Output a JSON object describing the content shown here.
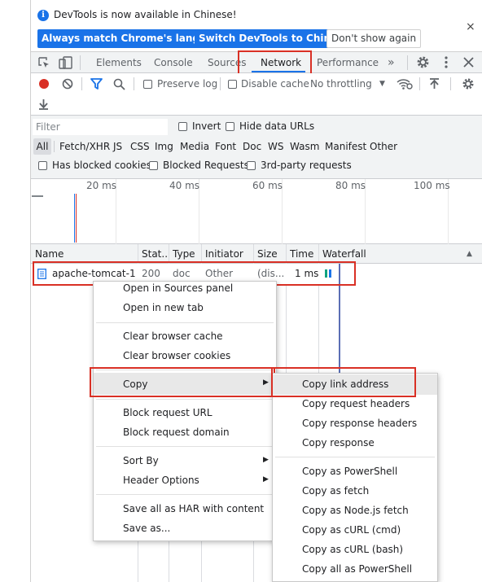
{
  "infobar": {
    "message": "DevTools is now available in Chinese!",
    "btn_match": "Always match Chrome's language",
    "btn_switch": "Switch DevTools to Chinese",
    "btn_dont_show": "Don't show again",
    "close": "×"
  },
  "tabs": [
    "Elements",
    "Console",
    "Sources",
    "Network",
    "Performance"
  ],
  "active_tab": "Network",
  "more_tabs": "»",
  "toolbar": {
    "preserve_log": "Preserve log",
    "disable_cache": "Disable cache",
    "throttling": "No throttling"
  },
  "filter": {
    "placeholder": "Filter",
    "invert": "Invert",
    "hide_data_urls": "Hide data URLs",
    "types": [
      "All",
      "Fetch/XHR",
      "JS",
      "CSS",
      "Img",
      "Media",
      "Font",
      "Doc",
      "WS",
      "Wasm",
      "Manifest",
      "Other"
    ],
    "has_blocked_cookies": "Has blocked cookies",
    "blocked_requests": "Blocked Requests",
    "third_party": "3rd-party requests"
  },
  "timeline": {
    "ticks": [
      "20 ms",
      "40 ms",
      "60 ms",
      "80 ms",
      "100 ms"
    ]
  },
  "table": {
    "headers": {
      "name": "Name",
      "status": "Stat...",
      "type": "Type",
      "initiator": "Initiator",
      "size": "Size",
      "time": "Time",
      "waterfall": "Waterfall"
    },
    "row": {
      "name": "apache-tomcat-1...",
      "status": "200",
      "type": "doc",
      "initiator": "Other",
      "size": "(dis...",
      "time": "1 ms"
    }
  },
  "context_menu": {
    "open_sources": "Open in Sources panel",
    "open_new_tab": "Open in new tab",
    "clear_cache": "Clear browser cache",
    "clear_cookies": "Clear browser cookies",
    "copy": "Copy",
    "block_url": "Block request URL",
    "block_domain": "Block request domain",
    "sort_by": "Sort By",
    "header_options": "Header Options",
    "save_har": "Save all as HAR with content",
    "save_as": "Save as..."
  },
  "copy_submenu": {
    "copy_link": "Copy link address",
    "copy_req_headers": "Copy request headers",
    "copy_resp_headers": "Copy response headers",
    "copy_response": "Copy response",
    "copy_powershell": "Copy as PowerShell",
    "copy_fetch": "Copy as fetch",
    "copy_nodejs": "Copy as Node.js fetch",
    "copy_curl_cmd": "Copy as cURL (cmd)",
    "copy_curl_bash": "Copy as cURL (bash)",
    "copy_all_powershell": "Copy all as PowerShell"
  },
  "colors": {
    "accent": "#1a73e8",
    "record": "#d93025",
    "highlight_box": "#d93025"
  }
}
